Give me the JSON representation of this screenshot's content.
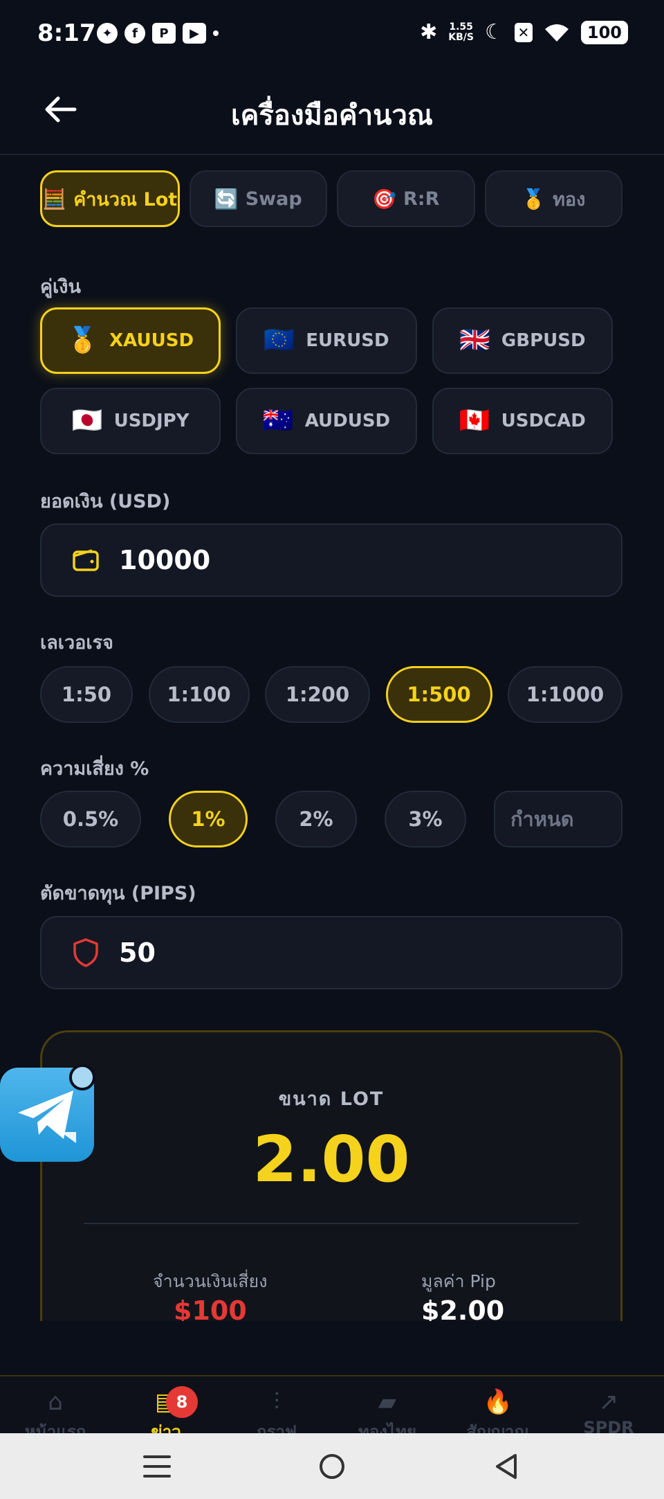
{
  "status_bar": {
    "time": "8:17",
    "apps": [
      "messenger-icon",
      "facebook-icon",
      "pixiv-icon",
      "youtube-icon"
    ],
    "net_speed_value": "1.55",
    "net_speed_unit": "KB/S",
    "battery": "100"
  },
  "header": {
    "title": "เครื่องมือคำนวณ"
  },
  "tabs": [
    {
      "icon": "🧮",
      "label": "คำนวณ Lot",
      "active": true
    },
    {
      "icon": "🔄",
      "label": "Swap",
      "active": false
    },
    {
      "icon": "🎯",
      "label": "R:R",
      "active": false
    },
    {
      "icon": "🥇",
      "label": "ทอง",
      "active": false
    }
  ],
  "pair_section": {
    "label": "คู่เงิน",
    "items": [
      {
        "flag": "🥇",
        "label": "XAUUSD",
        "active": true
      },
      {
        "flag": "🇪🇺",
        "label": "EURUSD",
        "active": false
      },
      {
        "flag": "🇬🇧",
        "label": "GBPUSD",
        "active": false
      },
      {
        "flag": "🇯🇵",
        "label": "USDJPY",
        "active": false
      },
      {
        "flag": "🇦🇺",
        "label": "AUDUSD",
        "active": false
      },
      {
        "flag": "🇨🇦",
        "label": "USDCAD",
        "active": false
      }
    ]
  },
  "balance": {
    "label": "ยอดเงิน (USD)",
    "value": "10000"
  },
  "leverage": {
    "label": "เลเวอเรจ",
    "options": [
      "1:50",
      "1:100",
      "1:200",
      "1:500",
      "1:1000"
    ],
    "selected_index": 3
  },
  "risk": {
    "label": "ความเสี่ยง %",
    "options": [
      "0.5%",
      "1%",
      "2%",
      "3%"
    ],
    "selected_index": 1,
    "custom_placeholder": "กำหนด"
  },
  "stop_loss": {
    "label": "ตัดขาดทุน (PIPS)",
    "value": "50"
  },
  "result": {
    "lot_label": "ขนาด LOT",
    "lot_value": "2.00",
    "risk_amount_label": "จำนวนเงินเสี่ยง",
    "risk_amount_value": "$100",
    "pip_value_label": "มูลค่า Pip",
    "pip_value_value": "$2.00"
  },
  "bottom_nav": {
    "items": [
      {
        "icon": "⌂",
        "label": "หน้าแรก"
      },
      {
        "icon": "▤",
        "label": "ข่าว",
        "badge": "8",
        "active": true
      },
      {
        "icon": "⫶",
        "label": "กราฟ"
      },
      {
        "icon": "▰",
        "label": "ทองไทย"
      },
      {
        "icon": "🔥",
        "label": "สัญญาณ"
      },
      {
        "icon": "↗",
        "label": "SPDR"
      }
    ]
  },
  "colors": {
    "background": "#0b0f19",
    "accent": "#f5d21c",
    "danger": "#e53935",
    "telegram": "#229ed9"
  }
}
